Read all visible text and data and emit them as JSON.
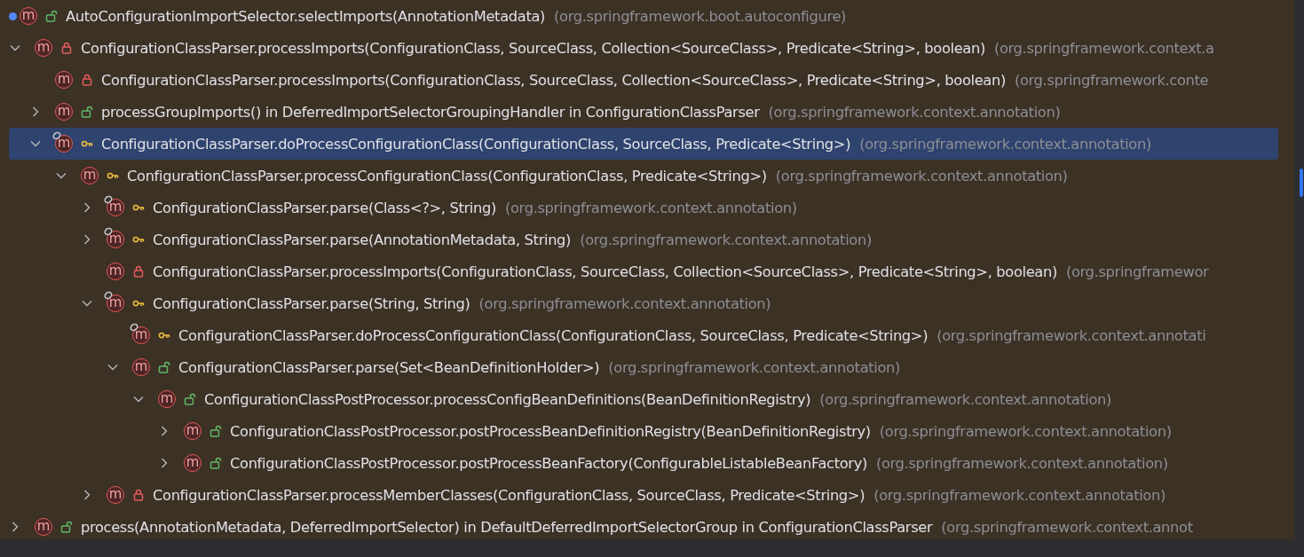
{
  "root": {
    "badge": "m",
    "method": "AutoConfigurationImportSelector.selectImports(AnnotationMetadata)",
    "package": "(org.springframework.boot.autoconfigure)",
    "kind": "public",
    "overrides": false,
    "selected": false
  },
  "tree": [
    {
      "badge": "m",
      "method": "ConfigurationClassParser.processImports(ConfigurationClass, SourceClass, Collection<SourceClass>, Predicate<String>, boolean)",
      "package": "(org.springframework.context.a",
      "kind": "private",
      "overrides": false,
      "expanded": true,
      "selected": false,
      "children": [
        {
          "badge": "m",
          "method": "ConfigurationClassParser.processImports(ConfigurationClass, SourceClass, Collection<SourceClass>, Predicate<String>, boolean)",
          "package": "(org.springframework.conte",
          "kind": "private",
          "overrides": false,
          "selected": false
        },
        {
          "badge": "m",
          "method": "processGroupImports() in DeferredImportSelectorGroupingHandler in ConfigurationClassParser",
          "package": "(org.springframework.context.annotation)",
          "kind": "public",
          "overrides": false,
          "expanded": false,
          "selected": false
        },
        {
          "badge": "m",
          "method": "ConfigurationClassParser.doProcessConfigurationClass(ConfigurationClass, SourceClass, Predicate<String>)",
          "package": "(org.springframework.context.annotation)",
          "kind": "package",
          "overrides": true,
          "expanded": true,
          "selected": true,
          "children": [
            {
              "badge": "m",
              "method": "ConfigurationClassParser.processConfigurationClass(ConfigurationClass, Predicate<String>)",
              "package": "(org.springframework.context.annotation)",
              "kind": "package",
              "overrides": false,
              "expanded": true,
              "selected": false,
              "children": [
                {
                  "badge": "m",
                  "method": "ConfigurationClassParser.parse(Class<?>, String)",
                  "package": "(org.springframework.context.annotation)",
                  "kind": "package",
                  "overrides": true,
                  "expanded": false,
                  "selected": false
                },
                {
                  "badge": "m",
                  "method": "ConfigurationClassParser.parse(AnnotationMetadata, String)",
                  "package": "(org.springframework.context.annotation)",
                  "kind": "package",
                  "overrides": true,
                  "expanded": false,
                  "selected": false
                },
                {
                  "badge": "m",
                  "method": "ConfigurationClassParser.processImports(ConfigurationClass, SourceClass, Collection<SourceClass>, Predicate<String>, boolean)",
                  "package": "(org.springframewor",
                  "kind": "private",
                  "overrides": false,
                  "selected": false
                },
                {
                  "badge": "m",
                  "method": "ConfigurationClassParser.parse(String, String)",
                  "package": "(org.springframework.context.annotation)",
                  "kind": "package",
                  "overrides": true,
                  "expanded": true,
                  "selected": false,
                  "children": [
                    {
                      "badge": "m",
                      "method": "ConfigurationClassParser.doProcessConfigurationClass(ConfigurationClass, SourceClass, Predicate<String>)",
                      "package": "(org.springframework.context.annotati",
                      "kind": "package",
                      "overrides": true,
                      "selected": false
                    },
                    {
                      "badge": "m",
                      "method": "ConfigurationClassParser.parse(Set<BeanDefinitionHolder>)",
                      "package": "(org.springframework.context.annotation)",
                      "kind": "public",
                      "overrides": false,
                      "expanded": true,
                      "selected": false,
                      "children": [
                        {
                          "badge": "m",
                          "method": "ConfigurationClassPostProcessor.processConfigBeanDefinitions(BeanDefinitionRegistry)",
                          "package": "(org.springframework.context.annotation)",
                          "kind": "public",
                          "overrides": false,
                          "expanded": true,
                          "selected": false,
                          "children": [
                            {
                              "badge": "m",
                              "method": "ConfigurationClassPostProcessor.postProcessBeanDefinitionRegistry(BeanDefinitionRegistry)",
                              "package": "(org.springframework.context.annotation)",
                              "kind": "public",
                              "overrides": false,
                              "expanded": false,
                              "selected": false
                            },
                            {
                              "badge": "m",
                              "method": "ConfigurationClassPostProcessor.postProcessBeanFactory(ConfigurableListableBeanFactory)",
                              "package": "(org.springframework.context.annotation)",
                              "kind": "public",
                              "overrides": false,
                              "expanded": false,
                              "selected": false
                            }
                          ]
                        }
                      ]
                    }
                  ]
                },
                {
                  "badge": "m",
                  "method": "ConfigurationClassParser.processMemberClasses(ConfigurationClass, SourceClass, Predicate<String>)",
                  "package": "(org.springframework.context.annotation)",
                  "kind": "private",
                  "overrides": false,
                  "expanded": false,
                  "selected": false
                }
              ]
            }
          ]
        }
      ]
    },
    {
      "badge": "m",
      "method": "process(AnnotationMetadata, DeferredImportSelector) in DefaultDeferredImportSelectorGroup in ConfigurationClassParser",
      "package": "(org.springframework.context.annot",
      "kind": "public",
      "overrides": false,
      "expanded": false,
      "selected": false
    }
  ]
}
